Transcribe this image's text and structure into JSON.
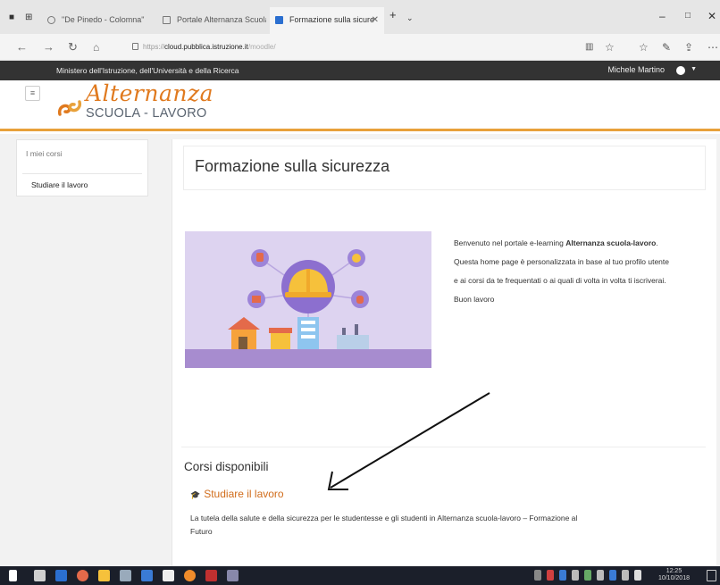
{
  "browser": {
    "tabs": [
      {
        "label": "\"De Pinedo - Colomna\""
      },
      {
        "label": "Portale Alternanza Scuola L"
      },
      {
        "label": "Formazione sulla sicure"
      }
    ],
    "address": {
      "domain": "cloud.pubblica.istruzione.it",
      "path": "/moodle/",
      "prefix": "https://"
    },
    "icons": [
      "back-icon",
      "forward-icon",
      "refresh-icon",
      "home-icon",
      "star-icon",
      "favorites-icon",
      "pen-icon",
      "share-icon",
      "more-icon"
    ]
  },
  "site": {
    "ministry": "Ministero dell'Istruzione, dell'Università e della Ricerca",
    "user_name": "Michele Martino",
    "logo": {
      "line1": "Alternanza",
      "line2": "SCUOLA - LAVORO"
    },
    "colors": {
      "accent": "#e07a1f",
      "topbar": "#333333",
      "link": "#d16d1c"
    }
  },
  "sidebar": {
    "title": "I miei corsi",
    "items": [
      {
        "label": "Studiare il lavoro"
      }
    ]
  },
  "main": {
    "page_title": "Formazione sulla sicurezza",
    "welcome": {
      "p1_pre": "Benvenuto nel portale e-learning ",
      "p1_bold": "Alternanza scuola-lavoro",
      "p1_post": ".",
      "p2": "Questa home page è personalizzata in base al tuo profilo utente",
      "p3": "e ai corsi da te frequentati o ai quali di volta in volta ti iscriverai.",
      "p4": "Buon lavoro"
    },
    "available_title": "Corsi disponibili",
    "course": {
      "name": "Studiare il lavoro",
      "description": "La tutela della salute e della sicurezza per le studentesse e gli studenti in Alternanza scuola-lavoro – Formazione al Futuro"
    }
  },
  "taskbar": {
    "time": "12:25",
    "date": "10/10/2018"
  }
}
